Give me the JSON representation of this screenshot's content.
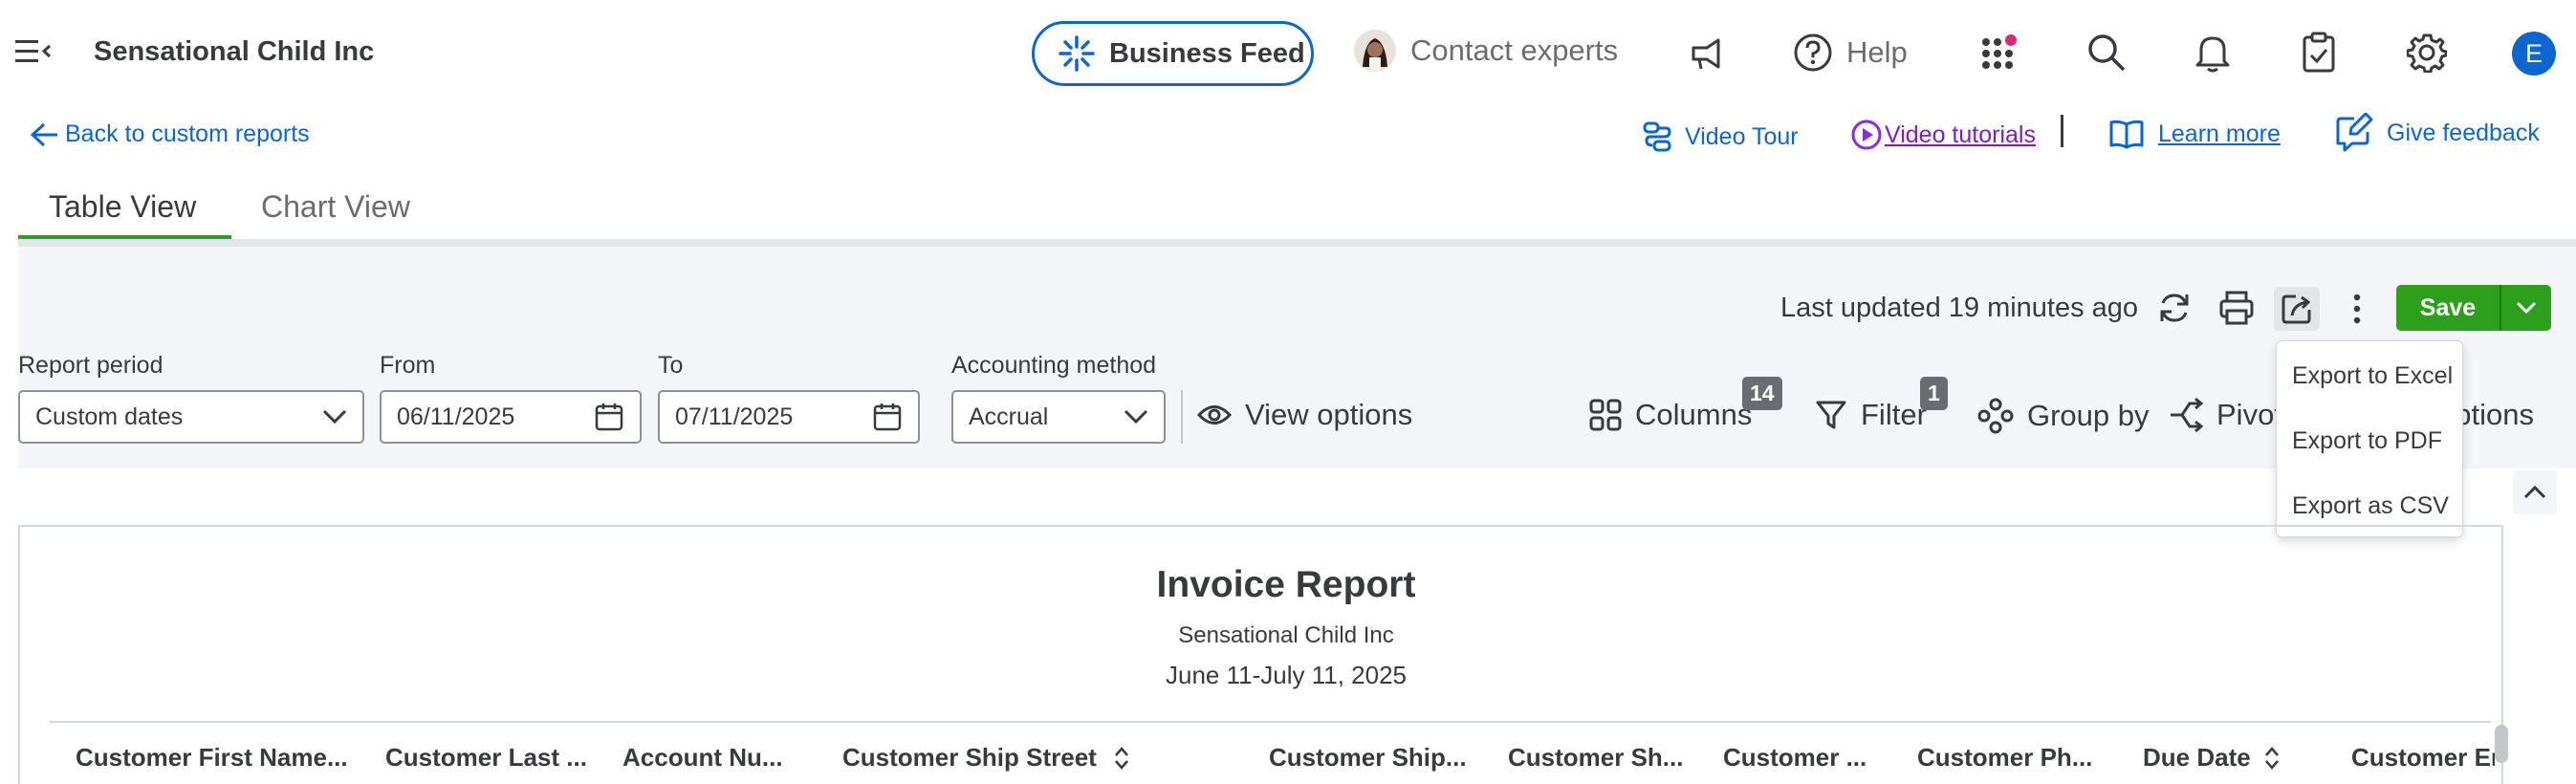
{
  "header": {
    "company_name": "Sensational Child Inc",
    "business_feed_label": "Business Feed",
    "contact_experts_label": "Contact experts",
    "help_label": "Help",
    "user_initial": "E"
  },
  "links": {
    "back": "Back to custom reports",
    "video_tour": "Video Tour",
    "video_tutorials": "Video tutorials",
    "learn_more": "Learn more",
    "give_feedback": "Give feedback"
  },
  "tabs": [
    {
      "label": "Table View",
      "active": true
    },
    {
      "label": "Chart View",
      "active": false
    }
  ],
  "toolbar": {
    "last_updated": "Last updated 19 minutes ago",
    "save_label": "Save"
  },
  "filters": {
    "report_period_label": "Report period",
    "report_period_value": "Custom dates",
    "from_label": "From",
    "from_value": "06/11/2025",
    "to_label": "To",
    "to_value": "07/11/2025",
    "accounting_method_label": "Accounting method",
    "accounting_method_value": "Accrual",
    "view_options_label": "View options"
  },
  "tools": {
    "columns_label": "Columns",
    "columns_count": "14",
    "filter_label": "Filter",
    "filter_count": "1",
    "group_by_label": "Group by",
    "pivot_label": "Pivot",
    "options_label": "options"
  },
  "export_menu": {
    "items": [
      "Export to Excel",
      "Export to PDF",
      "Export as CSV"
    ]
  },
  "report": {
    "title": "Invoice Report",
    "company": "Sensational Child Inc",
    "date_range": "June 11-July 11, 2025",
    "columns": [
      "Customer First Name...",
      "Customer Last ...",
      "Account Nu...",
      "Customer Ship Street",
      "Customer Ship...",
      "Customer Sh...",
      "Customer ...",
      "Customer Ph...",
      "Due Date",
      "Customer Em"
    ]
  },
  "colors": {
    "brand_blue": "#0d66d0",
    "save_green": "#2ca01c",
    "tab_underline": "#2ca01c",
    "notification_dot": "#d52b7c",
    "avatar_bg": "#0d66d0"
  }
}
